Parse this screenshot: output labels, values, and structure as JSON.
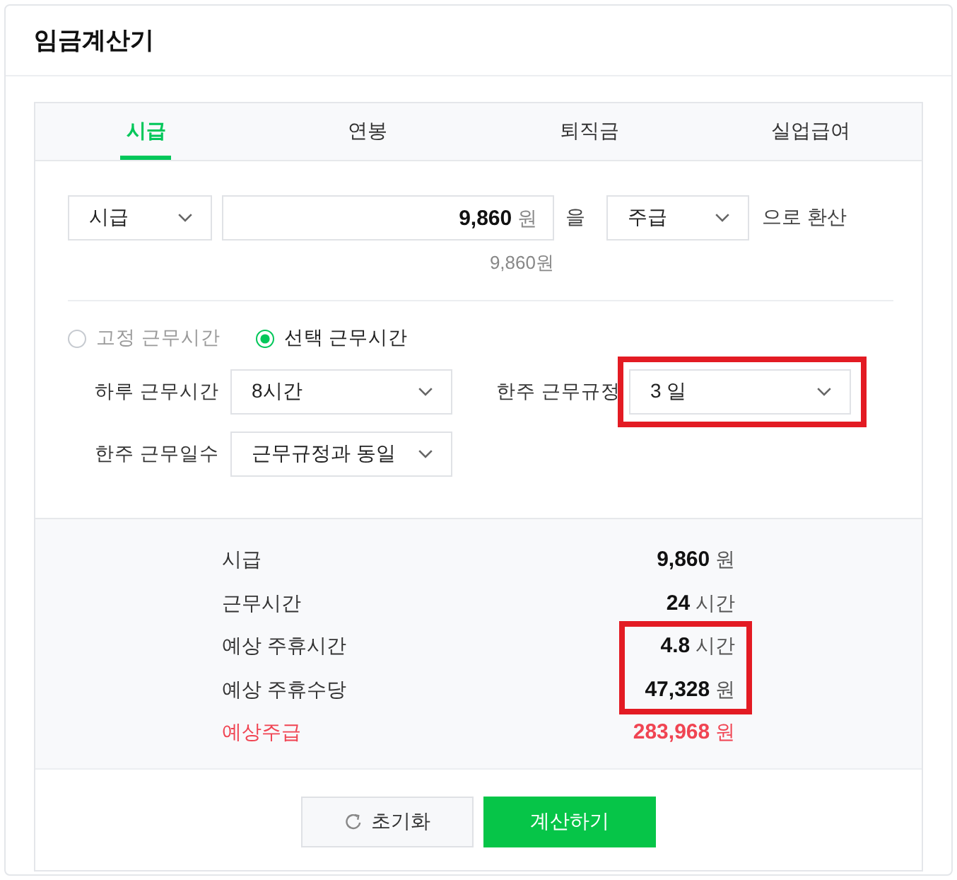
{
  "window": {
    "title": "임금계산기"
  },
  "tabs": [
    {
      "label": "시급",
      "selected": true
    },
    {
      "label": "연봉",
      "selected": false
    },
    {
      "label": "퇴직금",
      "selected": false
    },
    {
      "label": "실업급여",
      "selected": false
    }
  ],
  "converter": {
    "from_unit": "시급",
    "amount": "9,860",
    "currency": "원",
    "particle": "을",
    "to_unit": "주급",
    "suffix": "으로 환산",
    "amount_preview": "9,860원"
  },
  "work_time_mode": [
    {
      "label": "고정 근무시간",
      "selected": false
    },
    {
      "label": "선택 근무시간",
      "selected": true
    }
  ],
  "settings": [
    {
      "label": "하루 근무시간",
      "value": "8시간",
      "highlighted": false
    },
    {
      "label": "한주 근무규정",
      "value": "3 일",
      "highlighted": true
    },
    {
      "label": "한주 근무일수",
      "value": "근무규정과 동일",
      "highlighted": false
    }
  ],
  "results": [
    {
      "kind": "item",
      "label": "시급",
      "value": "9,860",
      "unit": "원",
      "highlighted": false
    },
    {
      "kind": "item",
      "label": "근무시간",
      "value": "24",
      "unit": "시간",
      "highlighted": false
    },
    {
      "kind": "item",
      "label": "예상 주휴시간",
      "value": "4.8",
      "unit": "시간",
      "highlighted": true
    },
    {
      "kind": "item",
      "label": "예상 주휴수당",
      "value": "47,328",
      "unit": "원",
      "highlighted": true
    },
    {
      "kind": "total",
      "label": "예상주급",
      "value": "283,968",
      "unit": "원",
      "highlighted": false
    }
  ],
  "buttons": [
    {
      "kind": "reset",
      "label": "초기화"
    },
    {
      "kind": "primary",
      "label": "계산하기"
    }
  ]
}
